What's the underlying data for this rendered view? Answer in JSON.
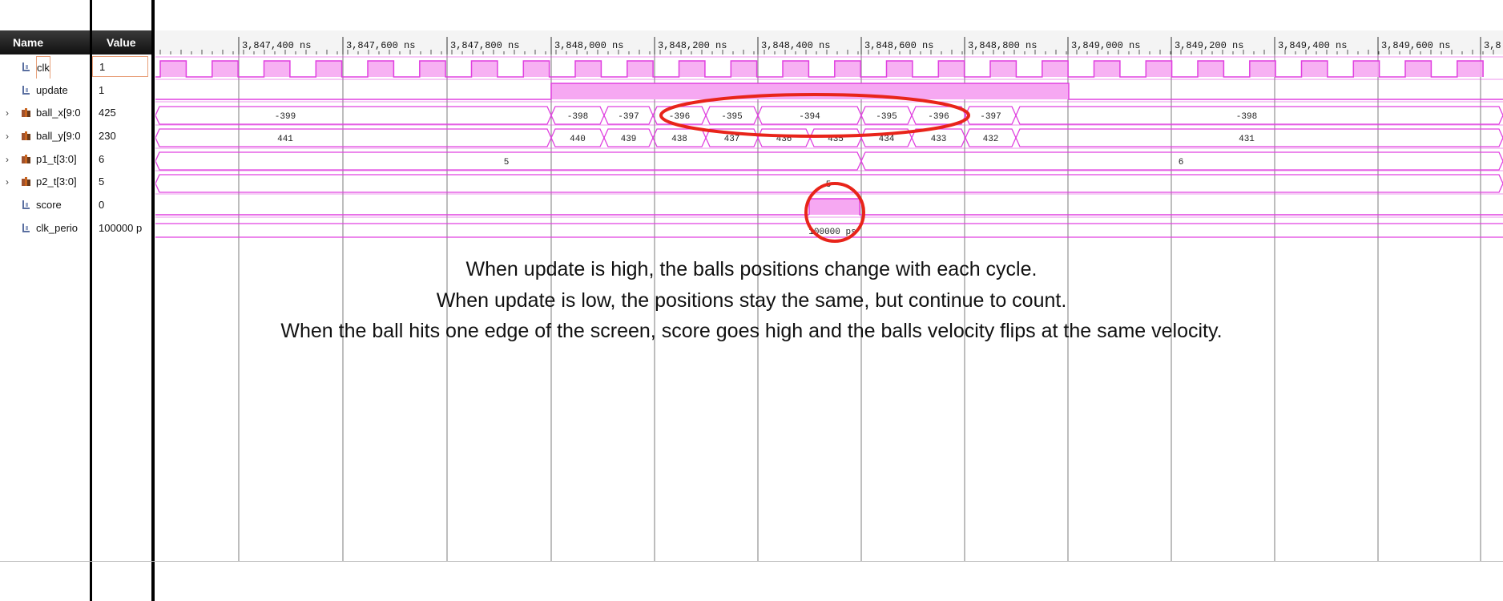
{
  "headers": {
    "name": "Name",
    "value": "Value"
  },
  "signals": [
    {
      "name": "clk",
      "value": "1",
      "icon": "scalar-icon",
      "expandable": false
    },
    {
      "name": "update",
      "value": "1",
      "icon": "scalar-icon",
      "expandable": false
    },
    {
      "name": "ball_x[9:0",
      "value": "425",
      "icon": "bus-icon",
      "expandable": true
    },
    {
      "name": "ball_y[9:0",
      "value": "230",
      "icon": "bus-icon",
      "expandable": true
    },
    {
      "name": "p1_t[3:0]",
      "value": "6",
      "icon": "bus-icon",
      "expandable": true
    },
    {
      "name": "p2_t[3:0]",
      "value": "5",
      "icon": "bus-icon",
      "expandable": true
    },
    {
      "name": "score",
      "value": "0",
      "icon": "scalar-icon",
      "expandable": false
    },
    {
      "name": "clk_perio",
      "value": "100000 p",
      "icon": "scalar-icon",
      "expandable": false
    }
  ],
  "timeline": {
    "ticks": [
      "3,847,400 ns",
      "3,847,600 ns",
      "3,847,800 ns",
      "3,848,000 ns",
      "3,848,200 ns",
      "3,848,400 ns",
      "3,848,600 ns",
      "3,848,800 ns",
      "3,849,000 ns",
      "3,849,200 ns",
      "3,849,400 ns",
      "3,849,600 ns",
      "3,8"
    ]
  },
  "waves": {
    "ball_x": {
      "labels": [
        "-399",
        "-398",
        "-397",
        "-396",
        "-395",
        "-394",
        "-395",
        "-396",
        "-397",
        "-398"
      ]
    },
    "ball_y": {
      "labels": [
        "441",
        "440",
        "439",
        "438",
        "437",
        "436",
        "435",
        "434",
        "433",
        "432",
        "431"
      ]
    },
    "p1_t": {
      "labels": [
        "5",
        "6"
      ]
    },
    "p2_t": {
      "labels": [
        "5"
      ]
    },
    "clk_perio": {
      "labels": [
        "100000 ps"
      ]
    }
  },
  "annotations": [
    "When update is high, the balls positions change with each cycle.",
    "When update is low, the positions stay the same, but continue to count.",
    "When the ball hits one edge of the screen, score goes high and the balls velocity flips at the same velocity."
  ],
  "colors": {
    "wave": "#e040e0",
    "fill": "#f6a8f2",
    "highlight": "#e8241a",
    "grid": "#9a9a9a"
  }
}
